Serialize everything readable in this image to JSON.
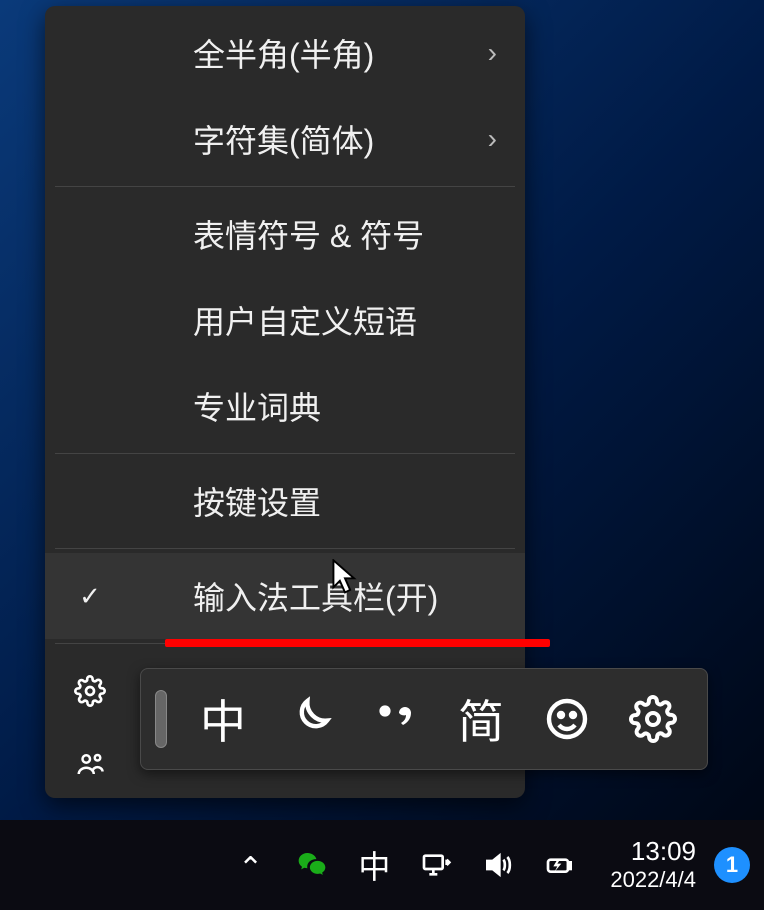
{
  "menu": {
    "items": [
      {
        "label": "全半角(半角)",
        "hasSubmenu": true
      },
      {
        "label": "字符集(简体)",
        "hasSubmenu": true
      },
      {
        "label": "表情符号 & 符号"
      },
      {
        "label": "用户自定义短语"
      },
      {
        "label": "专业词典"
      },
      {
        "label": "按键设置"
      },
      {
        "label": "输入法工具栏(开)",
        "checked": true,
        "highlighted": true
      },
      {
        "label": "设置",
        "icon": "gear"
      },
      {
        "label": "",
        "icon": "feedback"
      }
    ],
    "separators_after": [
      1,
      4,
      5,
      6
    ]
  },
  "imeToolbar": {
    "buttons": [
      {
        "name": "ime-mode-chinese",
        "text": "中"
      },
      {
        "name": "ime-halfmoon",
        "icon": "halfmoon"
      },
      {
        "name": "ime-punctuation",
        "icon": "punct"
      },
      {
        "name": "ime-charset",
        "text": "简"
      },
      {
        "name": "ime-emoji",
        "icon": "smile"
      },
      {
        "name": "ime-settings",
        "icon": "gear"
      }
    ]
  },
  "taskbar": {
    "ime_indicator": "中",
    "time": "13:09",
    "date": "2022/4/4",
    "notif_count": "1"
  }
}
